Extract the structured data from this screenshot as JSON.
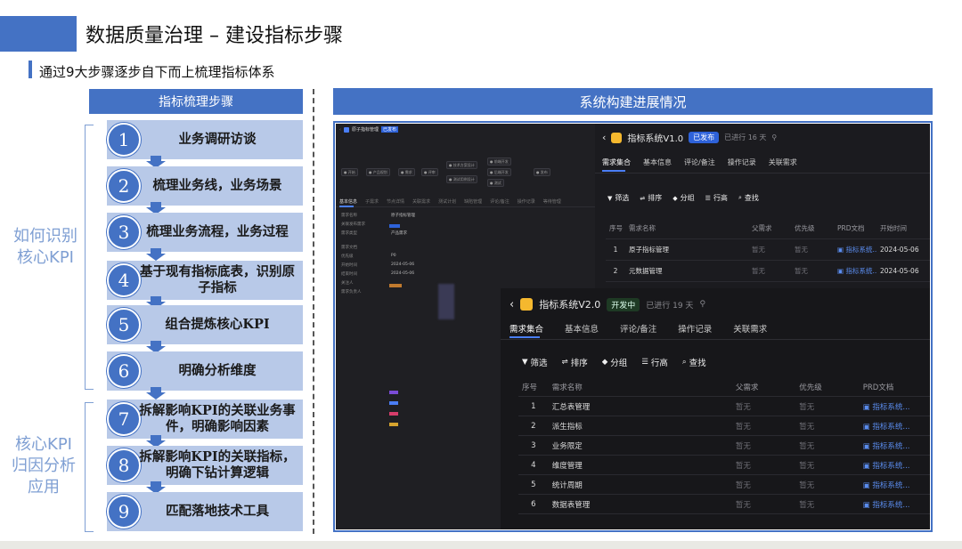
{
  "header": {
    "title": "数据质量治理 – 建设指标步骤",
    "subtitle": "通过9大步骤逐步自下而上梳理指标体系"
  },
  "colors": {
    "accent": "#4472c4",
    "step_bg": "#b8c9e8",
    "side_label": "#7f9fd3"
  },
  "left_panel": {
    "title": "指标梳理步骤",
    "steps": [
      {
        "num": "1",
        "text": "业务调研访谈"
      },
      {
        "num": "2",
        "text": "梳理业务线，业务场景"
      },
      {
        "num": "3",
        "text": "梳理业务流程，业务过程"
      },
      {
        "num": "4",
        "text": "基于现有指标底表，识别原子指标"
      },
      {
        "num": "5",
        "text": "组合提炼核心KPI"
      },
      {
        "num": "6",
        "text": "明确分析维度"
      },
      {
        "num": "7",
        "text": "拆解影响KPI的关联业务事件，明确影响因素"
      },
      {
        "num": "8",
        "text": "拆解影响KPI的关联指标，明确下钻计算逻辑"
      },
      {
        "num": "9",
        "text": "匹配落地技术工具"
      }
    ],
    "group1_label": "如何识别\n核心KPI",
    "group2_label": "核心KPI\n归因分析\n应用"
  },
  "right_panel": {
    "title": "系统构建进展情况",
    "shot1": {
      "breadcrumb": "原子指标管理",
      "badge": "已发布",
      "tabs": [
        "基本信息",
        "子需求",
        "节点详情",
        "关联需求",
        "测试计划",
        "缺陷管理",
        "评论/备注",
        "操作记录",
        "等待管理"
      ],
      "fields": [
        "需求名称",
        "关联发布需求",
        "需求类型",
        "需求文档",
        "优先级",
        "开始时间",
        "结束时间",
        "关注人",
        "需求负责人"
      ],
      "values": [
        "原子指标管理",
        "产品需求",
        "P0",
        "2024-05-06",
        "2024-05-06"
      ]
    },
    "shot2": {
      "title": "指标系统V1.0",
      "status": "已发布",
      "elapsed": "已进行 16 天",
      "tabs": [
        "需求集合",
        "基本信息",
        "评论/备注",
        "操作记录",
        "关联需求"
      ],
      "toolbar": [
        "筛选",
        "排序",
        "分组",
        "行高",
        "查找"
      ],
      "columns": [
        "序号",
        "需求名称",
        "父需求",
        "优先级",
        "PRD文档",
        "开始时间"
      ],
      "rows": [
        {
          "no": "1",
          "name": "原子指标管理",
          "parent": "暂无",
          "priority": "暂无",
          "prd": "指标系统...",
          "start": "2024-05-06"
        },
        {
          "no": "2",
          "name": "元数据管理",
          "parent": "暂无",
          "priority": "暂无",
          "prd": "指标系统...",
          "start": "2024-05-06"
        }
      ]
    },
    "shot3": {
      "title": "指标系统V2.0",
      "status": "开发中",
      "elapsed": "已进行 19 天",
      "tabs": [
        "需求集合",
        "基本信息",
        "评论/备注",
        "操作记录",
        "关联需求"
      ],
      "toolbar": [
        "筛选",
        "排序",
        "分组",
        "行高",
        "查找"
      ],
      "columns": [
        "序号",
        "需求名称",
        "父需求",
        "优先级",
        "PRD文档"
      ],
      "rows": [
        {
          "no": "1",
          "name": "汇总表管理",
          "parent": "暂无",
          "priority": "暂无",
          "prd": "指标系统..."
        },
        {
          "no": "2",
          "name": "派生指标",
          "parent": "暂无",
          "priority": "暂无",
          "prd": "指标系统..."
        },
        {
          "no": "3",
          "name": "业务限定",
          "parent": "暂无",
          "priority": "暂无",
          "prd": "指标系统..."
        },
        {
          "no": "4",
          "name": "维度管理",
          "parent": "暂无",
          "priority": "暂无",
          "prd": "指标系统..."
        },
        {
          "no": "5",
          "name": "统计周期",
          "parent": "暂无",
          "priority": "暂无",
          "prd": "指标系统..."
        },
        {
          "no": "6",
          "name": "数据表管理",
          "parent": "暂无",
          "priority": "暂无",
          "prd": "指标系统..."
        }
      ]
    }
  }
}
